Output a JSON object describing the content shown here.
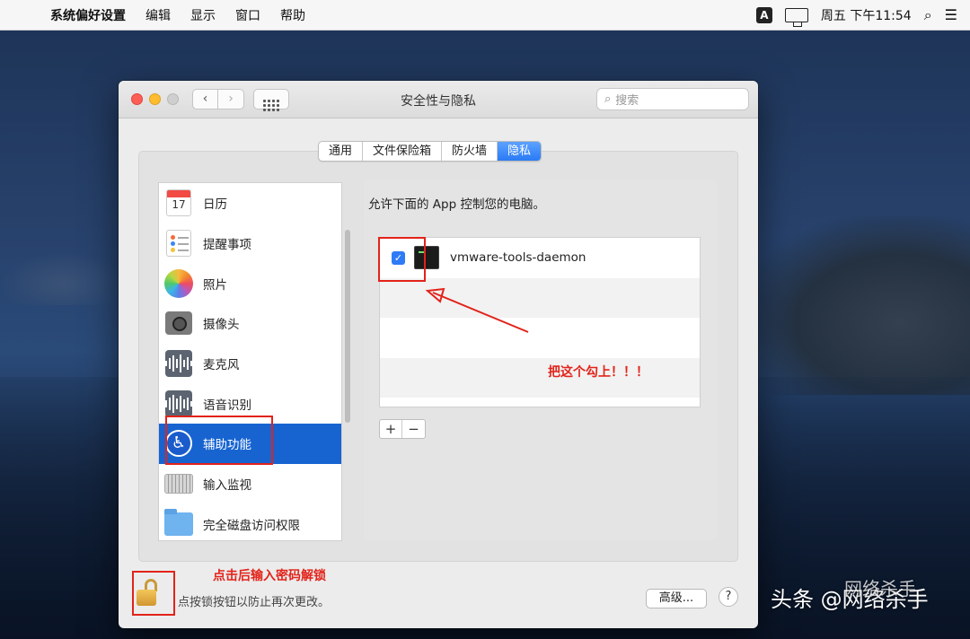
{
  "menubar": {
    "app_name": "系统偏好设置",
    "menus": [
      "编辑",
      "显示",
      "窗口",
      "帮助"
    ],
    "ime": "A",
    "clock": "周五 下午11:54"
  },
  "window": {
    "title": "安全性与隐私",
    "search_placeholder": "搜索",
    "tabs": [
      "通用",
      "文件保险箱",
      "防火墙",
      "隐私"
    ],
    "active_tab": "隐私"
  },
  "sidebar": {
    "items": [
      {
        "label": "日历",
        "icon": "calendar-icon",
        "selected": false
      },
      {
        "label": "提醒事项",
        "icon": "reminders-icon",
        "selected": false
      },
      {
        "label": "照片",
        "icon": "photos-icon",
        "selected": false
      },
      {
        "label": "摄像头",
        "icon": "camera-icon",
        "selected": false
      },
      {
        "label": "麦克风",
        "icon": "microphone-icon",
        "selected": false
      },
      {
        "label": "语音识别",
        "icon": "speech-recognition-icon",
        "selected": false
      },
      {
        "label": "辅助功能",
        "icon": "accessibility-icon",
        "selected": true
      },
      {
        "label": "输入监视",
        "icon": "keyboard-icon",
        "selected": false
      },
      {
        "label": "完全磁盘访问权限",
        "icon": "folder-icon",
        "selected": false
      }
    ],
    "calendar_day": "17"
  },
  "main": {
    "description": "允许下面的 App 控制您的电脑。",
    "apps": [
      {
        "name": "vmware-tools-daemon",
        "checked": true
      }
    ],
    "add_label": "+",
    "remove_label": "−"
  },
  "footer": {
    "lock_text": "点按锁按钮以防止再次更改。",
    "advanced_label": "高级...",
    "help_label": "?"
  },
  "annotations": {
    "check_note": "把这个勾上！！！",
    "lock_note": "点击后输入密码解锁",
    "color": "#e2231a"
  },
  "watermark": {
    "main": "头条 @网络杀手",
    "sub": "网络杀手"
  }
}
